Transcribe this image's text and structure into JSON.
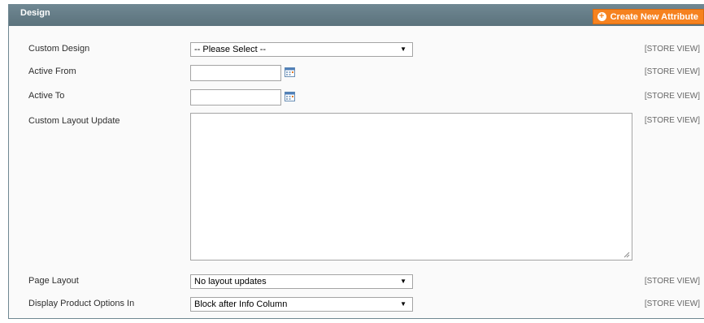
{
  "panel": {
    "title": "Design",
    "create_button": "Create New Attribute"
  },
  "scope_label": "[STORE VIEW]",
  "fields": {
    "custom_design": {
      "label": "Custom Design",
      "value": "-- Please Select --"
    },
    "active_from": {
      "label": "Active From",
      "value": ""
    },
    "active_to": {
      "label": "Active To",
      "value": ""
    },
    "custom_layout_update": {
      "label": "Custom Layout Update",
      "value": ""
    },
    "page_layout": {
      "label": "Page Layout",
      "value": "No layout updates"
    },
    "display_product_options": {
      "label": "Display Product Options In",
      "value": "Block after Info Column"
    }
  },
  "icons": {
    "calendar": "calendar-icon",
    "dropdown": "chevron-down-icon",
    "add": "plus-icon"
  },
  "colors": {
    "header": "#6f8792",
    "accent_button": "#f6821f"
  }
}
